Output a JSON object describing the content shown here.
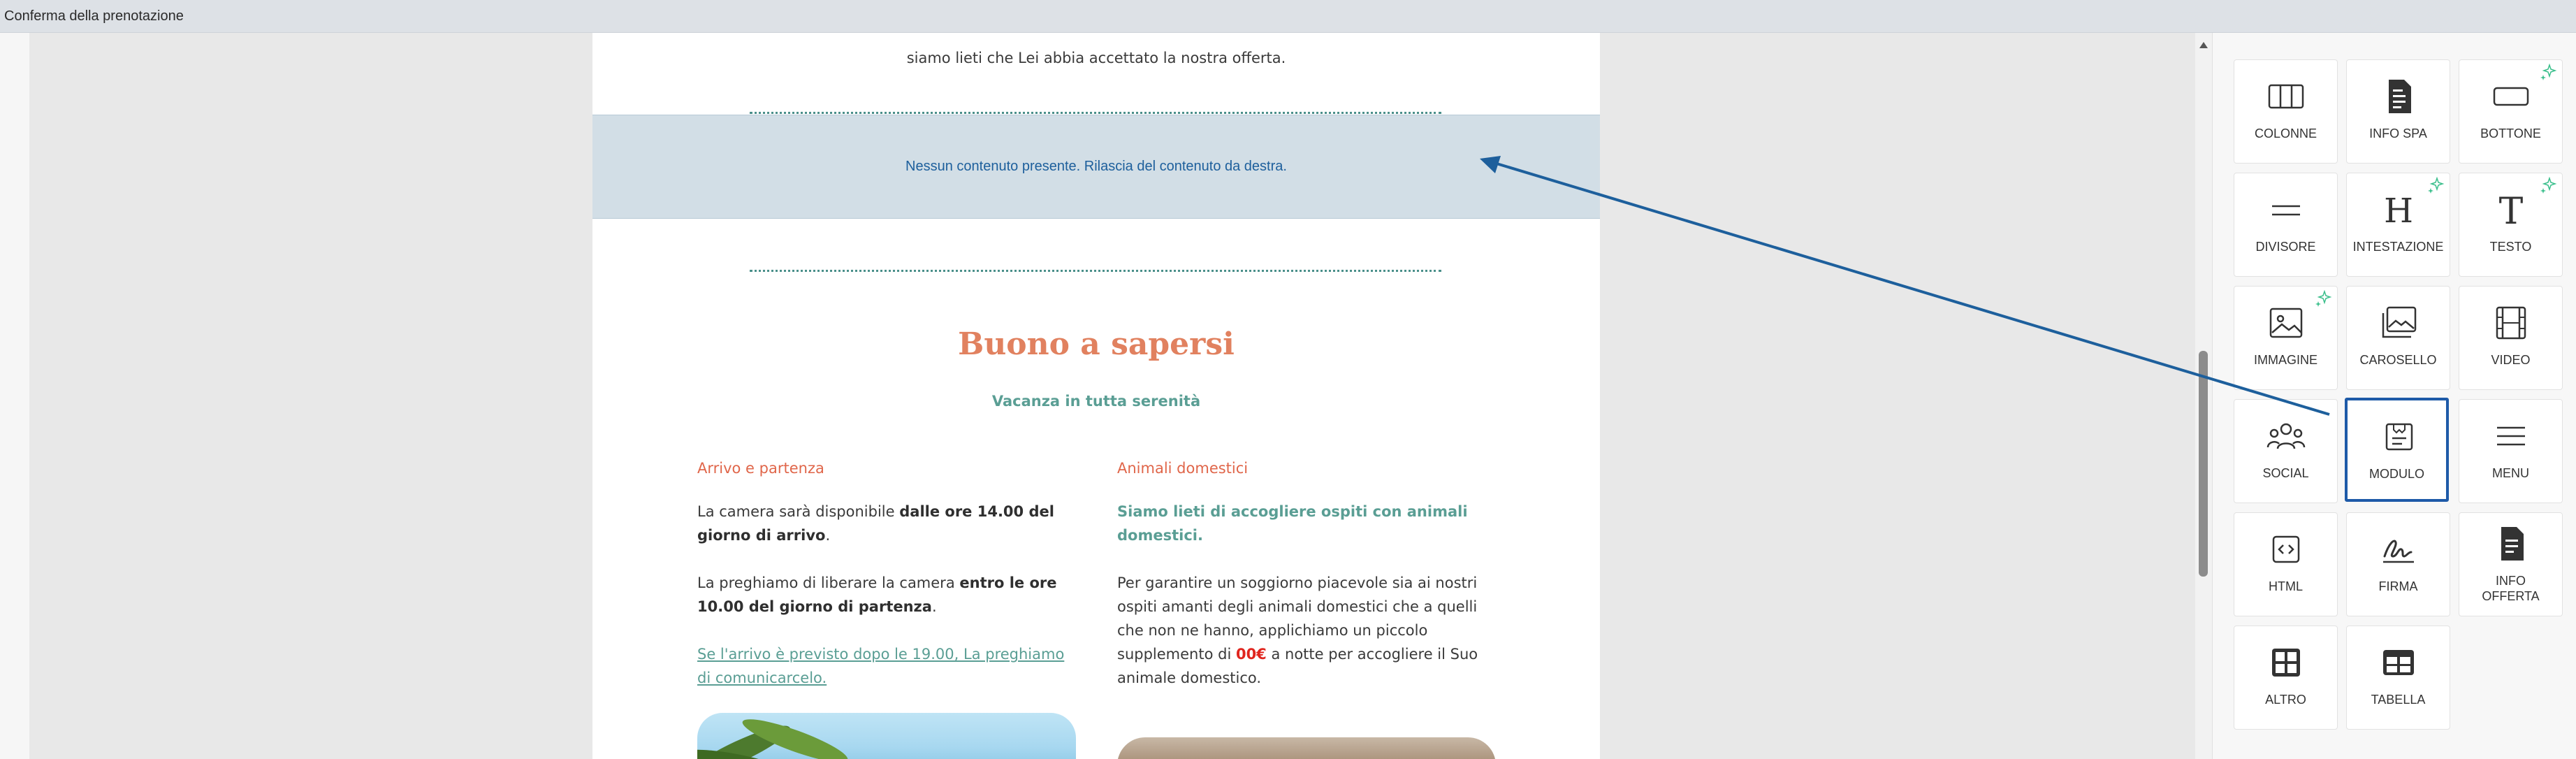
{
  "window": {
    "title": "Conferma della prenotazione"
  },
  "email": {
    "intro_text": "siamo lieti che Lei abbia accettato la nostra offerta.",
    "dropzone_text": "Nessun contenuto presente. Rilascia del contenuto da destra.",
    "section_title": "Buono a sapersi",
    "section_subtitle": "Vacanza in tutta serenità",
    "col1": {
      "heading": "Arrivo e partenza",
      "p1_a": "La camera sarà disponibile ",
      "p1_b": "dalle ore 14.00 del giorno di arrivo",
      "p1_c": ".",
      "p2_a": "La preghiamo di liberare la camera ",
      "p2_b": "entro le ore 10.00 del giorno di partenza",
      "p2_c": ".",
      "p3_link": " Se l'arrivo è previsto dopo le 19.00, La preghiamo di comunicarcelo."
    },
    "col2": {
      "heading": "Animali domestici",
      "p1": "Siamo lieti di accogliere ospiti con animali domestici.",
      "p2_a": "Per garantire un soggiorno piacevole sia ai nostri ospiti amanti degli animali domestici che a quelli che non ne hanno, applichiamo un piccolo supplemento di ",
      "p2_price": "00€",
      "p2_b": " a notte per accogliere il Suo animale domestico."
    }
  },
  "panel": {
    "tiles": [
      {
        "label": "COLONNE",
        "icon": "columns-icon",
        "sparkle": false
      },
      {
        "label": "INFO SPA",
        "icon": "spa-info-icon",
        "sparkle": false
      },
      {
        "label": "BOTTONE",
        "icon": "button-icon",
        "sparkle": true
      },
      {
        "label": "DIVISORE",
        "icon": "divider-icon",
        "sparkle": false
      },
      {
        "label": "INTESTAZIONE",
        "icon": "heading-icon",
        "sparkle": true
      },
      {
        "label": "TESTO",
        "icon": "text-icon",
        "sparkle": true
      },
      {
        "label": "IMMAGINE",
        "icon": "image-icon",
        "sparkle": true
      },
      {
        "label": "CAROSELLO",
        "icon": "carousel-icon",
        "sparkle": false
      },
      {
        "label": "VIDEO",
        "icon": "video-icon",
        "sparkle": false
      },
      {
        "label": "SOCIAL",
        "icon": "social-icon",
        "sparkle": false
      },
      {
        "label": "MODULO",
        "icon": "form-icon",
        "sparkle": false,
        "selected": true
      },
      {
        "label": "MENU",
        "icon": "menu-icon",
        "sparkle": false
      },
      {
        "label": "HTML",
        "icon": "html-icon",
        "sparkle": false
      },
      {
        "label": "FIRMA",
        "icon": "signature-icon",
        "sparkle": false
      },
      {
        "label": "INFO OFFERTA",
        "icon": "offer-info-icon",
        "sparkle": false
      },
      {
        "label": "ALTRO",
        "icon": "other-icon",
        "sparkle": false
      },
      {
        "label": "TABELLA",
        "icon": "table-icon",
        "sparkle": false
      }
    ]
  },
  "colors": {
    "accent_selected": "#1e5aa8",
    "dropzone_bg": "#d2dee6",
    "title_coral": "#e1815f",
    "teal": "#5a9e94",
    "sparkle_green": "#3bbf8c"
  }
}
